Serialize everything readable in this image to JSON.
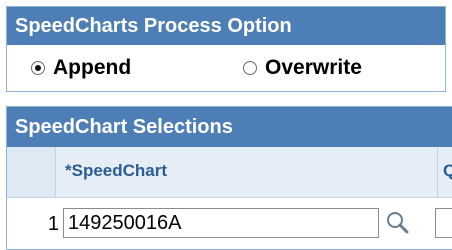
{
  "process_option": {
    "title": "SpeedCharts Process Option",
    "options": [
      {
        "label": "Append",
        "selected": true
      },
      {
        "label": "Overwrite",
        "selected": false
      }
    ]
  },
  "selections": {
    "title": "SpeedChart Selections",
    "columns": {
      "speedchart": "*SpeedChart",
      "next": "Q"
    },
    "rows": [
      {
        "num": "1",
        "speedchart": "149250016A"
      }
    ]
  },
  "icons": {
    "lookup": "magnifier-icon"
  },
  "colors": {
    "header_bg": "#4d7fb6",
    "header_text": "#ffffff",
    "column_header_bg": "#e5eef7",
    "column_header_text": "#2b5c93"
  }
}
